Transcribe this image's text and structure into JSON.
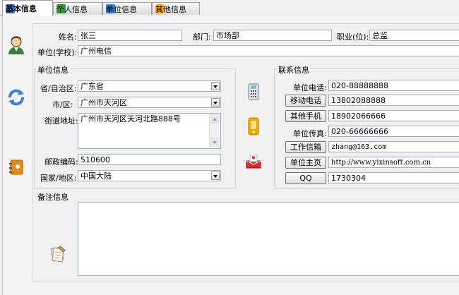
{
  "tabs": [
    {
      "label": "基本信息"
    },
    {
      "label": "个人信息"
    },
    {
      "label": "单位信息"
    },
    {
      "label": "其他信息"
    }
  ],
  "basic": {
    "name_label": "姓名:",
    "name_value": "张三",
    "dept_label": "部门:",
    "dept_value": "市场部",
    "title_label": "职业(位):",
    "title_value": "总监",
    "company_label": "单位(学校):",
    "company_value": "广州电信"
  },
  "company_info": {
    "group_title": "单位信息",
    "province_label": "省/自治区:",
    "province_value": "广东省",
    "city_label": "市/区:",
    "city_value": "广州市天河区",
    "street_label": "街道地址:",
    "street_value": "广州市天河区天河北路888号",
    "zip_label": "邮政编码:",
    "zip_value": "510600",
    "country_label": "国家/地区:",
    "country_value": "中国大陆"
  },
  "contact": {
    "group_title": "联系信息",
    "work_phone_label": "单位电话:",
    "work_phone_value": "020-88888888",
    "mobile_button": "移动电话",
    "mobile_value": "13802088888",
    "other_mobile_button": "其他手机",
    "other_mobile_value": "18902066666",
    "fax_label": "单位传真:",
    "fax_value": "020-66666666",
    "email_button": "工作信箱",
    "email_value": "zhang@163.com",
    "homepage_button": "单位主页",
    "homepage_value": "http://www.yixinsoft.com.cn",
    "qq_button": "QQ",
    "qq_value": "1730304"
  },
  "notes": {
    "group_title": "备注信息",
    "value": ""
  },
  "colors": {
    "tab_active_bg": "#ffffff",
    "panel_bg": "#f0f0f0",
    "input_border": "#a5acb5"
  }
}
